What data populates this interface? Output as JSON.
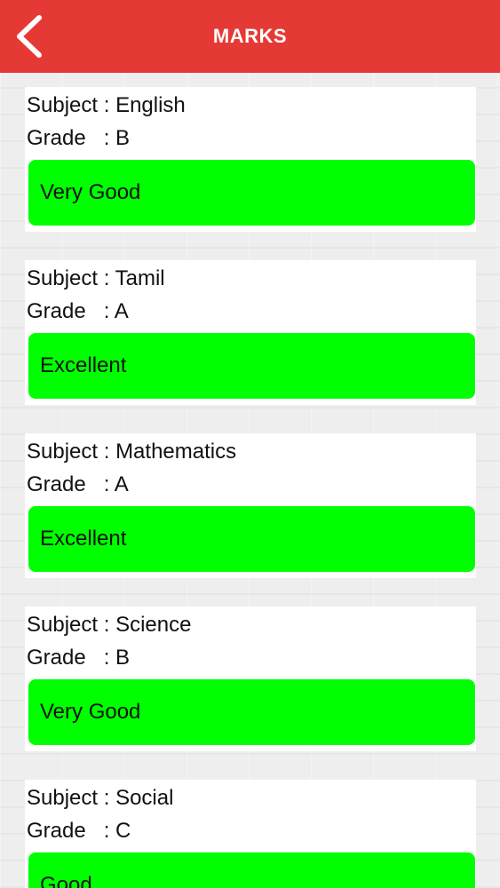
{
  "header": {
    "title": "MARKS"
  },
  "labels": {
    "subject_prefix": "Subject : ",
    "grade_prefix": "Grade   : "
  },
  "marks": [
    {
      "subject": "English",
      "grade": "B",
      "remark": "Very Good"
    },
    {
      "subject": "Tamil",
      "grade": "A",
      "remark": "Excellent"
    },
    {
      "subject": "Mathematics",
      "grade": "A",
      "remark": "Excellent"
    },
    {
      "subject": "Science",
      "grade": "B",
      "remark": "Very Good"
    },
    {
      "subject": "Social",
      "grade": "C",
      "remark": "Good"
    }
  ],
  "colors": {
    "header": "#e53935",
    "remark_box": "#00ff00",
    "card": "#ffffff"
  },
  "icons": {
    "back": "chevron-left-icon"
  }
}
